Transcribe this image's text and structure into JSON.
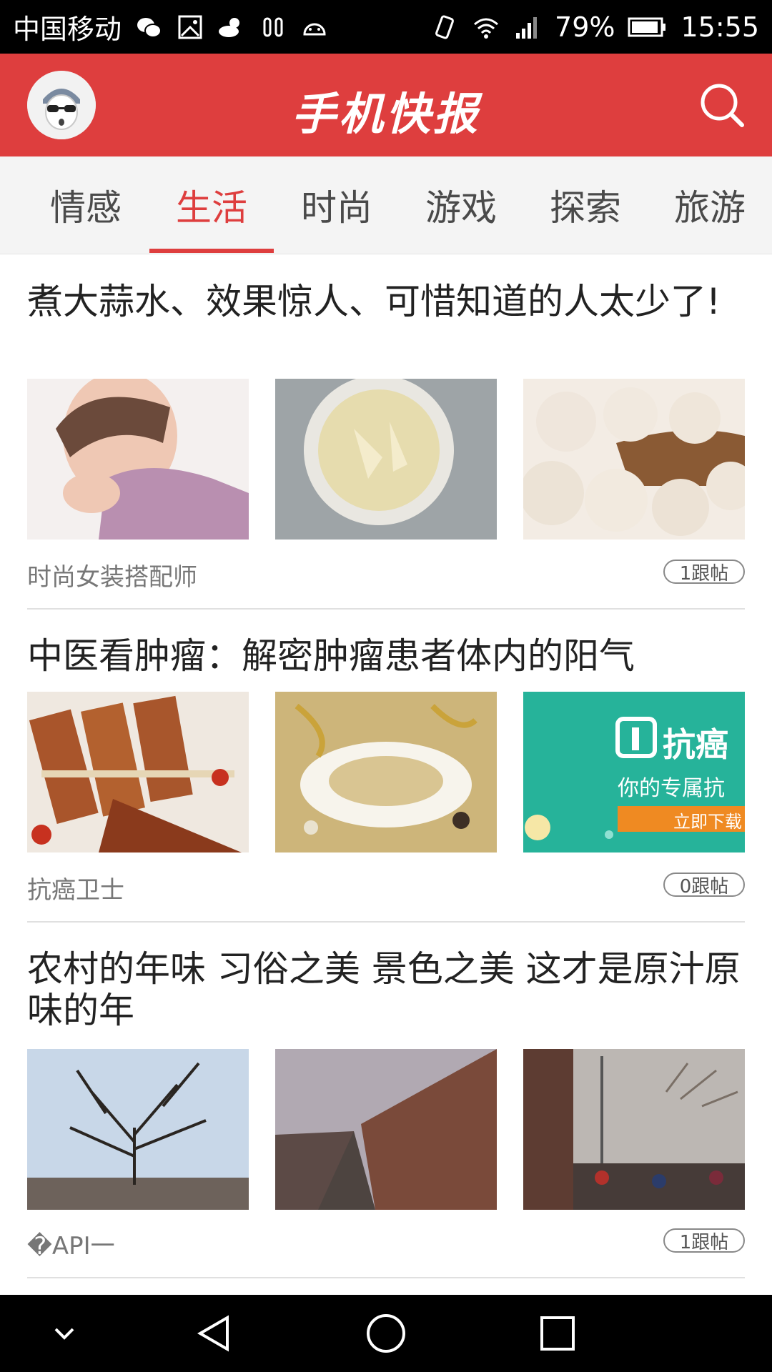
{
  "status_bar": {
    "carrier": "中国移动",
    "battery": "79%",
    "time": "15:55"
  },
  "header": {
    "logo": "手机快报",
    "avatar_icon": "avatar-icon",
    "search_icon": "search-icon"
  },
  "tabs": [
    {
      "label": "情感",
      "active": false
    },
    {
      "label": "生活",
      "active": true
    },
    {
      "label": "时尚",
      "active": false
    },
    {
      "label": "游戏",
      "active": false
    },
    {
      "label": "探索",
      "active": false
    },
    {
      "label": "旅游",
      "active": false
    }
  ],
  "articles": [
    {
      "title": "煮大蒜水、效果惊人、可惜知道的人太少了!",
      "source": "时尚女装搭配师",
      "replies": "1跟帖"
    },
    {
      "title": "中医看肿瘤：解密肿瘤患者体内的阳气",
      "source": "抗癌卫士",
      "replies": "0跟帖",
      "image_text": {
        "brand": "抗癌",
        "tagline": "你的专属抗",
        "button": "立即下载"
      }
    },
    {
      "title": "农村的年味 习俗之美 景色之美 这才是原汁原味的年",
      "source": "�API一",
      "replies": "1跟帖"
    }
  ],
  "colors": {
    "accent": "#de3e3e",
    "status_bar": "#000000",
    "nav_bar": "#000000"
  }
}
